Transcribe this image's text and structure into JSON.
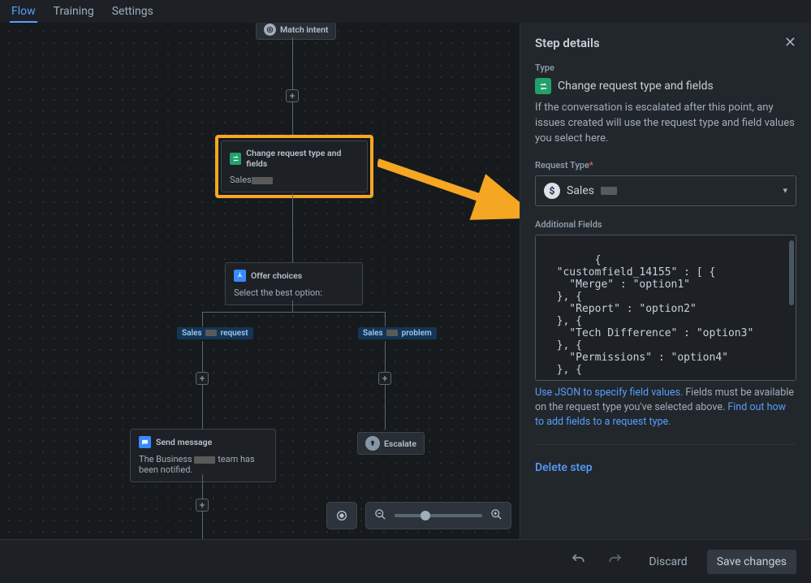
{
  "tabs": {
    "flow": "Flow",
    "training": "Training",
    "settings": "Settings"
  },
  "canvas": {
    "match_intent": "Match intent",
    "change_card": {
      "title": "Change request type and fields",
      "value": "Sales"
    },
    "offer_card": {
      "title": "Offer choices",
      "body": "Select the best option:"
    },
    "branch_left": {
      "a": "Sales",
      "b": "request"
    },
    "branch_right": {
      "a": "Sales",
      "b": "problem"
    },
    "send_card": {
      "title": "Send message",
      "body1": "The Business",
      "body2": "team has been notified."
    },
    "escalate": "Escalate"
  },
  "panel": {
    "title": "Step details",
    "type_label": "Type",
    "type_name": "Change request type and fields",
    "description": "If the conversation is escalated after this point, any issues created will use the request type and field values you select here.",
    "request_type_label": "Request Type",
    "request_type_value": "Sales",
    "additional_label": "Additional Fields",
    "json_text": "{\n  \"customfield_14155\" : [ {\n    \"Merge\" : \"option1\"\n  }, {\n    \"Report\" : \"option2\"\n  }, {\n    \"Tech Difference\" : \"option3\"\n  }, {\n    \"Permissions\" : \"option4\"\n  }, {",
    "helper_link1": "Use JSON to specify field values.",
    "helper_text": " Fields must be available on the request type you've selected above. ",
    "helper_link2": "Find out how to add fields to a request type.",
    "delete": "Delete step"
  },
  "footer": {
    "discard": "Discard",
    "save": "Save changes"
  }
}
